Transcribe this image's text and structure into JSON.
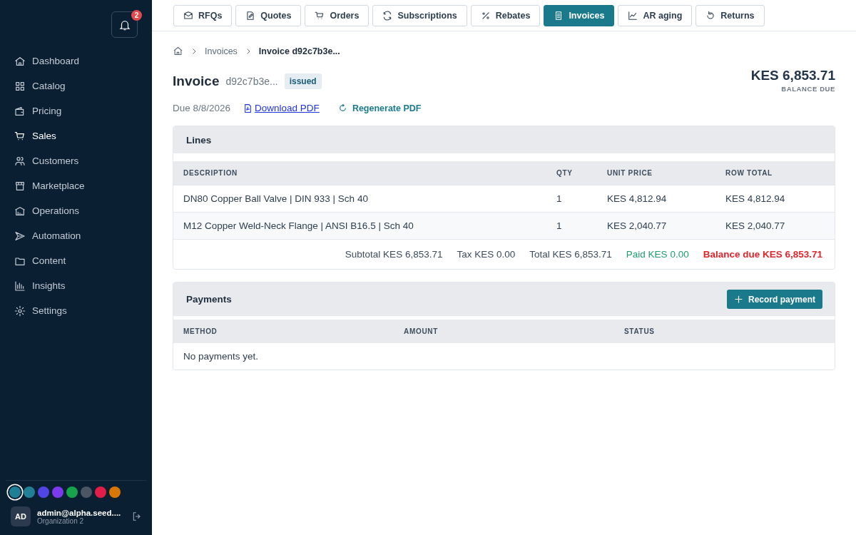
{
  "notifications": {
    "count": "2"
  },
  "sidebar": {
    "items": [
      {
        "label": "Dashboard",
        "selected": false
      },
      {
        "label": "Catalog",
        "selected": false
      },
      {
        "label": "Pricing",
        "selected": false
      },
      {
        "label": "Sales",
        "selected": true
      },
      {
        "label": "Customers",
        "selected": false
      },
      {
        "label": "Marketplace",
        "selected": false
      },
      {
        "label": "Operations",
        "selected": false
      },
      {
        "label": "Automation",
        "selected": false
      },
      {
        "label": "Content",
        "selected": false
      },
      {
        "label": "Insights",
        "selected": false
      },
      {
        "label": "Settings",
        "selected": false
      }
    ]
  },
  "theme_colors": [
    {
      "color": "#1f7f95",
      "selected": true
    },
    {
      "color": "#217f96",
      "selected": false
    },
    {
      "color": "#4f46e5",
      "selected": false
    },
    {
      "color": "#7c3aed",
      "selected": false
    },
    {
      "color": "#16a34a",
      "selected": false
    },
    {
      "color": "#4b5563",
      "selected": false
    },
    {
      "color": "#e11d48",
      "selected": false
    },
    {
      "color": "#d97706",
      "selected": false
    }
  ],
  "user": {
    "initials": "AD",
    "email": "admin@alpha.seed....",
    "org": "Organization 2"
  },
  "tabs": [
    {
      "label": "RFQs",
      "selected": false
    },
    {
      "label": "Quotes",
      "selected": false
    },
    {
      "label": "Orders",
      "selected": false
    },
    {
      "label": "Subscriptions",
      "selected": false
    },
    {
      "label": "Rebates",
      "selected": false
    },
    {
      "label": "Invoices",
      "selected": true
    },
    {
      "label": "AR aging",
      "selected": false
    },
    {
      "label": "Returns",
      "selected": false
    }
  ],
  "breadcrumb": [
    "Invoices",
    "Invoice d92c7b3e..."
  ],
  "invoice": {
    "title": "Invoice",
    "id": "d92c7b3e...",
    "status": "issued",
    "balance": "KES 6,853.71",
    "balance_label": "BALANCE DUE",
    "due": "Due 8/8/2026",
    "download": "Download PDF",
    "regenerate": "Regenerate PDF"
  },
  "lines": {
    "title": "Lines",
    "columns": [
      "DESCRIPTION",
      "QTY",
      "UNIT PRICE",
      "ROW TOTAL"
    ],
    "rows": [
      [
        "DN80 Copper Ball Valve | DIN 933 | Sch 40",
        "1",
        "KES 4,812.94",
        "KES 4,812.94"
      ],
      [
        "M12 Copper Weld-Neck Flange | ANSI B16.5 | Sch 40",
        "1",
        "KES 2,040.77",
        "KES 2,040.77"
      ]
    ],
    "totals": [
      {
        "text": "Subtotal KES 6,853.71",
        "kind": "plain"
      },
      {
        "text": "Tax KES 0.00",
        "kind": "plain"
      },
      {
        "text": "Total KES 6,853.71",
        "kind": "plain"
      },
      {
        "text": "Paid KES 0.00",
        "kind": "paid"
      },
      {
        "text": "Balance due KES 6,853.71",
        "kind": "balance"
      }
    ]
  },
  "payments": {
    "title": "Payments",
    "button": "Record payment",
    "columns": [
      "METHOD",
      "AMOUNT",
      "STATUS"
    ],
    "empty": "No payments yet."
  }
}
